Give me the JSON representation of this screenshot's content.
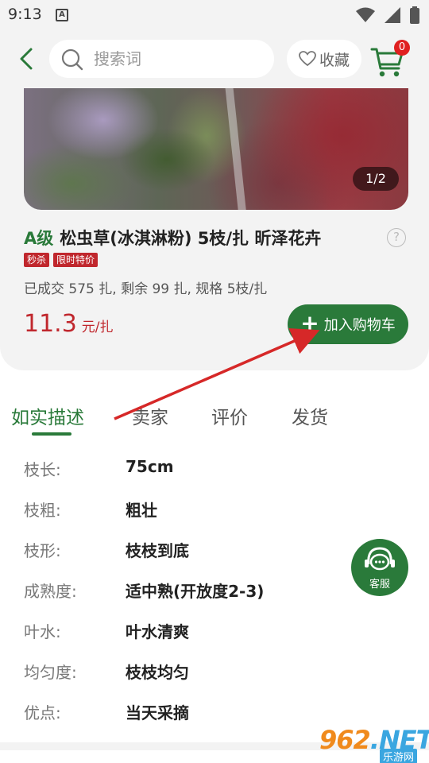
{
  "status_bar": {
    "time": "9:13",
    "app_badge": "A"
  },
  "header": {
    "search_placeholder": "搜索词",
    "favorite_label": "收藏",
    "cart_count": "0"
  },
  "product": {
    "image_counter": "1/2",
    "grade": "A级",
    "title": "松虫草(冰淇淋粉) 5枝/扎 昕泽花卉",
    "help": "?",
    "tags": [
      "秒杀",
      "限时特价"
    ],
    "stats": "已成交 575 扎, 剩余 99 扎, 规格 5枝/扎",
    "price": "11.3",
    "price_unit": "元/扎",
    "add_to_cart_label": "加入购物车"
  },
  "tabs": [
    "如实描述",
    "卖家",
    "评价",
    "发货"
  ],
  "active_tab": 0,
  "details": [
    {
      "label": "枝长:",
      "value": "75cm"
    },
    {
      "label": "枝粗:",
      "value": "粗壮"
    },
    {
      "label": "枝形:",
      "value": "枝枝到底"
    },
    {
      "label": "成熟度:",
      "value": "适中熟(开放度2-3)"
    },
    {
      "label": "叶水:",
      "value": "叶水清爽"
    },
    {
      "label": "均匀度:",
      "value": "枝枝均匀"
    },
    {
      "label": "优点:",
      "value": "当天采摘"
    }
  ],
  "customer_service_label": "客服",
  "watermark": {
    "logo_main": "962",
    "logo_suffix": ".NET",
    "sub": "乐游网"
  },
  "colors": {
    "brand_green": "#2a7a3a",
    "price_red": "#c0272d",
    "annotation_red": "#d62828"
  }
}
